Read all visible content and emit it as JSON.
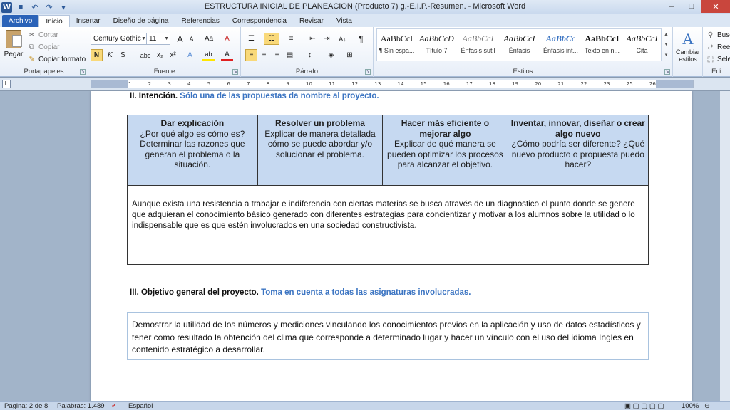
{
  "window": {
    "title": "ESTRUCTURA INICIAL DE PLANEACION  (Producto 7) g.-E.I.P.-Resumen.  -  Microsoft Word",
    "app_icon": "W",
    "controls": [
      "–",
      "□",
      "✕"
    ]
  },
  "qat": {
    "save": "💾",
    "undo": "↶",
    "redo": "↷"
  },
  "tabs": [
    "Archivo",
    "Inicio",
    "Insertar",
    "Diseño de página",
    "Referencias",
    "Correspondencia",
    "Revisar",
    "Vista"
  ],
  "ribbon": {
    "clipboard": {
      "paste": "Pegar",
      "cut": "Cortar",
      "copy": "Copiar",
      "format_painter": "Copiar formato",
      "label": "Portapapeles"
    },
    "font": {
      "name": "Century Gothic",
      "size": "11",
      "bold": "N",
      "italic": "K",
      "underline": "S",
      "strike": "abc",
      "sub": "x₂",
      "sup": "x²",
      "grow": "A",
      "shrink": "A",
      "case": "Aa",
      "clear": "A",
      "effects": "A",
      "highlight": "ab",
      "color": "A",
      "label": "Fuente"
    },
    "paragraph": {
      "label": "Párrafo",
      "pilcrow": "¶",
      "sort": "A↓"
    },
    "styles": {
      "label": "Estilos",
      "items": [
        {
          "sample": "AaBbCcI",
          "name": "¶ Sin espa..."
        },
        {
          "sample": "AaBbCcD",
          "name": "Título 7"
        },
        {
          "sample": "AaBbCcI",
          "name": "Énfasis sutil"
        },
        {
          "sample": "AaBbCcI",
          "name": "Énfasis"
        },
        {
          "sample": "AaBbCc",
          "name": "Énfasis int..."
        },
        {
          "sample": "AaBbCcI",
          "name": "Texto en n..."
        },
        {
          "sample": "AaBbCcI",
          "name": "Cita"
        }
      ],
      "change": "Cambiar estilos"
    },
    "editing": {
      "find": "Busc",
      "replace": "Reer",
      "select": "Sele",
      "label": "Edi"
    }
  },
  "ruler": {
    "ticks": [
      "1",
      "2",
      "3",
      "4",
      "5",
      "6",
      "7",
      "8",
      "9",
      "10",
      "11",
      "12",
      "13",
      "14",
      "15",
      "16",
      "17",
      "18",
      "19",
      "20",
      "21",
      "22",
      "23",
      "25",
      "26"
    ]
  },
  "document": {
    "section2": {
      "title": "II. Intención.",
      "subtitle": "Sólo una de las propuestas da nombre al proyecto."
    },
    "table": {
      "headers": [
        {
          "title": "Dar explicación",
          "text": "¿Por qué algo es cómo es? Determinar las razones que generan el problema o la situación."
        },
        {
          "title": "Resolver un problema",
          "text": "Explicar de manera detallada cómo se puede abordar y/o solucionar el problema."
        },
        {
          "title": "Hacer más eficiente o mejorar algo",
          "text": "Explicar de qué manera se pueden optimizar los procesos para alcanzar el objetivo."
        },
        {
          "title": "Inventar, innovar,  diseñar o crear algo nuevo",
          "text": "¿Cómo podría ser diferente? ¿Qué nuevo producto o propuesta puedo hacer?"
        }
      ],
      "body": "Aunque exista una resistencia  a trabajar  e indiferencia  con ciertas materias se busca através de un diagnostico  el punto donde se genere que adquieran  el  conocimiento  básico  generado con diferentes estrategias para concientizar y motivar a los alumnos  sobre la utilidad o lo indispensable que es que estén involucrados  en una sociedad constructivista."
    },
    "section3": {
      "title": "III.  Objetivo general del proyecto.",
      "subtitle": "Toma en cuenta a todas las asignaturas  involucradas."
    },
    "objective": "Demostrar la utilidad de los números y mediciones  vinculando los conocimientos previos en la  aplicación y  uso de datos estadísticos y tener como resultado la obtención del clima que corresponde a determinado lugar y  hacer   un vínculo con el uso del idioma  Ingles  en contenido  estratégico  a desarrollar."
  },
  "status": {
    "page": "Página: 2 de 8",
    "words": "Palabras: 1.489",
    "language": "Español",
    "zoom": "100%"
  }
}
